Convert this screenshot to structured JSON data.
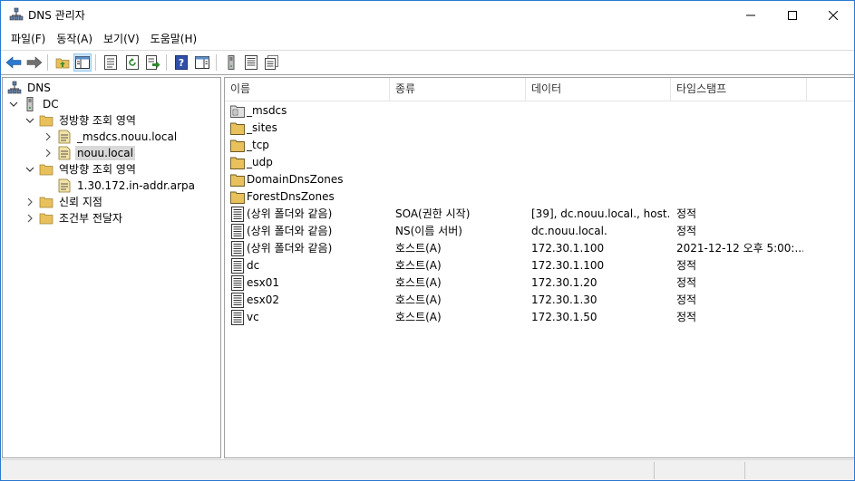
{
  "window": {
    "title": "DNS 관리자",
    "minimize_icon": "minimize-icon",
    "maximize_icon": "maximize-icon",
    "close_icon": "close-icon"
  },
  "menu": [
    "파일(F)",
    "동작(A)",
    "보기(V)",
    "도움말(H)"
  ],
  "toolbar": {
    "buttons": [
      "back-arrow-icon",
      "forward-arrow-icon",
      "up-folder-icon",
      "show-hide-tree-icon",
      "properties-icon",
      "refresh-icon",
      "export-list-icon",
      "help-icon",
      "action-pane-icon",
      "server-icon",
      "record-list-icon",
      "record-copy-icon"
    ]
  },
  "tree": {
    "root": "DNS",
    "server": "DC",
    "forward_zones": "정방향 조회 영역",
    "forward_children": [
      "_msdcs.nouu.local",
      "nouu.local"
    ],
    "reverse_zones": "역방향 조회 영역",
    "reverse_children": [
      "1.30.172.in-addr.arpa"
    ],
    "trust_points": "신뢰 지점",
    "conditional_forwarders": "조건부 전달자",
    "selected": "nouu.local"
  },
  "list": {
    "columns": [
      "이름",
      "종류",
      "데이터",
      "타임스탬프"
    ],
    "rows": [
      {
        "icon": "delegated-zone-icon",
        "name": "_msdcs",
        "type": "",
        "data": "",
        "timestamp": ""
      },
      {
        "icon": "folder-icon",
        "name": "_sites",
        "type": "",
        "data": "",
        "timestamp": ""
      },
      {
        "icon": "folder-icon",
        "name": "_tcp",
        "type": "",
        "data": "",
        "timestamp": ""
      },
      {
        "icon": "folder-icon",
        "name": "_udp",
        "type": "",
        "data": "",
        "timestamp": ""
      },
      {
        "icon": "folder-icon",
        "name": "DomainDnsZones",
        "type": "",
        "data": "",
        "timestamp": ""
      },
      {
        "icon": "folder-icon",
        "name": "ForestDnsZones",
        "type": "",
        "data": "",
        "timestamp": ""
      },
      {
        "icon": "record-icon",
        "name": "(상위 폴더와 같음)",
        "type": "SOA(권한 시작)",
        "data": "[39], dc.nouu.local., host...",
        "timestamp": "정적"
      },
      {
        "icon": "record-icon",
        "name": "(상위 폴더와 같음)",
        "type": "NS(이름 서버)",
        "data": "dc.nouu.local.",
        "timestamp": "정적"
      },
      {
        "icon": "record-icon",
        "name": "(상위 폴더와 같음)",
        "type": "호스트(A)",
        "data": "172.30.1.100",
        "timestamp": "2021-12-12 오후 5:00:..."
      },
      {
        "icon": "record-icon",
        "name": "dc",
        "type": "호스트(A)",
        "data": "172.30.1.100",
        "timestamp": "정적"
      },
      {
        "icon": "record-icon",
        "name": "esx01",
        "type": "호스트(A)",
        "data": "172.30.1.20",
        "timestamp": "정적"
      },
      {
        "icon": "record-icon",
        "name": "esx02",
        "type": "호스트(A)",
        "data": "172.30.1.30",
        "timestamp": "정적"
      },
      {
        "icon": "record-icon",
        "name": "vc",
        "type": "호스트(A)",
        "data": "172.30.1.50",
        "timestamp": "정적"
      }
    ]
  },
  "colors": {
    "accent": "#2b79d0",
    "selection": "#d9d9d9",
    "folder": "#e8c15c"
  }
}
